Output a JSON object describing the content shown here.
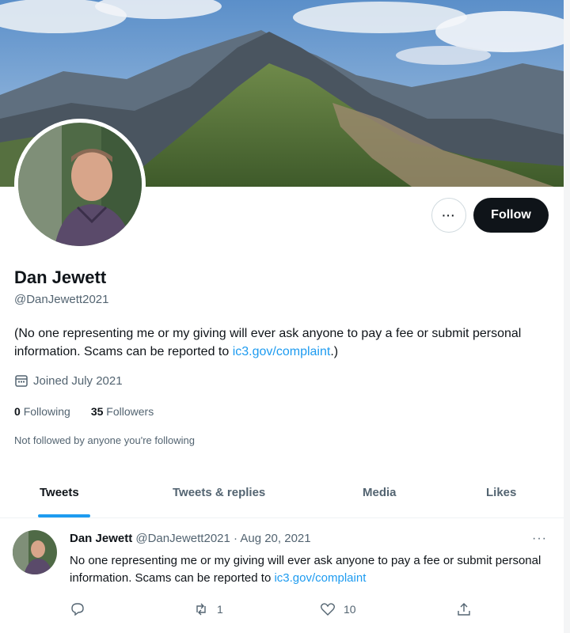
{
  "profile": {
    "name": "Dan Jewett",
    "handle": "@DanJewett2021",
    "bio_text": "(No one representing me or my giving will ever ask anyone to pay a fee or submit personal information. Scams can be reported to ",
    "bio_link": "ic3.gov/complaint",
    "bio_end": ".)",
    "joined": "Joined July 2021",
    "following_count": "0",
    "following_label": "Following",
    "followers_count": "35",
    "followers_label": "Followers",
    "not_followed": "Not followed by anyone you're following"
  },
  "actions": {
    "more_label": "···",
    "follow_label": "Follow"
  },
  "tabs": [
    {
      "label": "Tweets"
    },
    {
      "label": "Tweets & replies"
    },
    {
      "label": "Media"
    },
    {
      "label": "Likes"
    }
  ],
  "tweet": {
    "name": "Dan Jewett",
    "handle": "@DanJewett2021",
    "separator": " · ",
    "date": "Aug 20, 2021",
    "more": "···",
    "text": "No one representing me or my giving will ever ask anyone to pay a fee or submit personal information.  Scams can be reported to ",
    "link": "ic3.gov/complaint",
    "retweets": "1",
    "likes": "10"
  },
  "icons": {
    "calendar": "calendar-icon",
    "reply": "reply-icon",
    "retweet": "retweet-icon",
    "like": "heart-icon",
    "share": "share-icon"
  },
  "colors": {
    "accent": "#1d9bf0",
    "text": "#0f1419",
    "muted": "#536471"
  }
}
